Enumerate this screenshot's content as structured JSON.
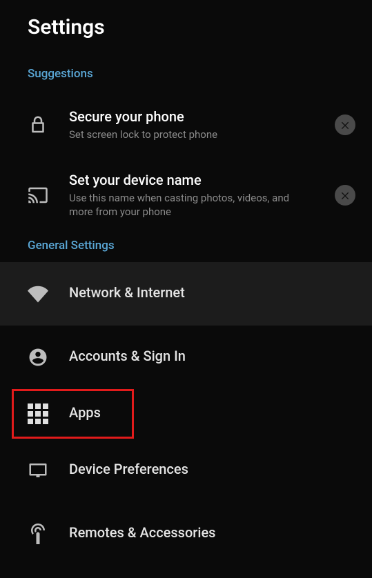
{
  "header": {
    "title": "Settings"
  },
  "sections": {
    "suggestions": "Suggestions",
    "general": "General Settings"
  },
  "suggestions": {
    "secure": {
      "title": "Secure your phone",
      "subtitle": "Set screen lock to protect phone"
    },
    "deviceName": {
      "title": "Set your device name",
      "subtitle": "Use this name when casting photos, videos, and more from your phone"
    }
  },
  "general": {
    "network": "Network & Internet",
    "accounts": "Accounts & Sign In",
    "apps": "Apps",
    "devicePrefs": "Device Preferences",
    "remotes": "Remotes & Accessories"
  }
}
